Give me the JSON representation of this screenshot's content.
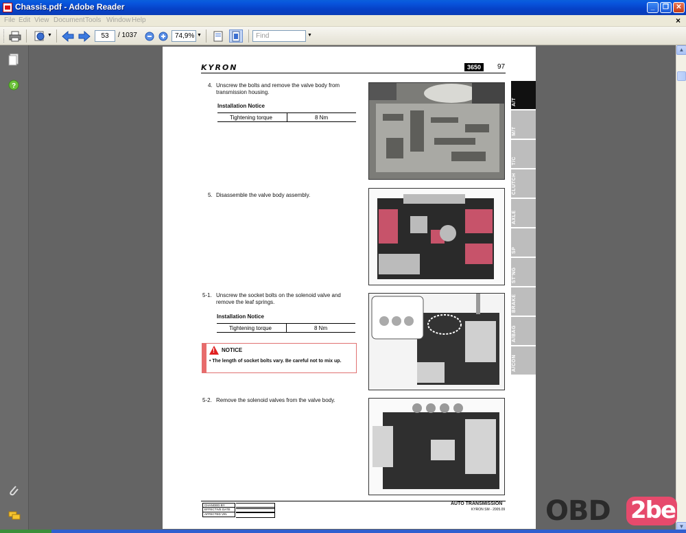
{
  "window": {
    "title": "Chassis.pdf - Adobe Reader"
  },
  "menu": {
    "items": [
      "File",
      "Edit",
      "View",
      "Document",
      "Tools",
      "Window",
      "Help"
    ]
  },
  "toolbar": {
    "page_current": "53",
    "page_total": "/ 1037",
    "zoom": "74,9%",
    "find_placeholder": "Find"
  },
  "icons": [
    "print-icon",
    "hand-tool-icon",
    "prev-page-icon",
    "next-page-icon",
    "zoom-out-icon",
    "zoom-in-icon",
    "fit-page-icon",
    "pages-icon",
    "help-icon",
    "attachment-icon",
    "comments-icon"
  ],
  "page": {
    "brand": "KYRON",
    "code": "3650",
    "number": "97",
    "steps": [
      {
        "num": "4.",
        "text_line1": "Unscrew the bolts and remove the valve body from",
        "text_line2": "transmission housing."
      },
      {
        "num": "5.",
        "text_line1": "Disassemble the valve body assembly."
      },
      {
        "num": "5-1.",
        "text_line1": "Unscrew the socket  bolts on the solenoid valve and",
        "text_line2": "remove the leaf springs."
      },
      {
        "num": "5-2.",
        "text_line1": "Remove the solenoid valves from the valve body."
      }
    ],
    "installation_notice_1": "Installation Notice",
    "installation_notice_2": "Installation Notice",
    "torque_label_1": "Tightening torque",
    "torque_value_1": "8 Nm",
    "torque_label_2": "Tightening torque",
    "torque_value_2": "8 Nm",
    "notice": {
      "title": "NOTICE",
      "text": "•  The length of socket bolts vary. Be careful not to mix up."
    },
    "side_tabs": [
      "A/T",
      "M/T",
      "T/C",
      "CLUTCH",
      "AXLE",
      "SP",
      "ST'NG",
      "BRAKE",
      "A/BAG",
      "A/CON"
    ],
    "footer": {
      "rows": [
        "CHANGED BY",
        "EFFECTIVE DATE",
        "AFFECTED VIN"
      ],
      "title": "AUTO TRANSMISSION",
      "sub": "KYRON SM - 2005.09"
    }
  },
  "watermark": {
    "text": "OBD",
    "badge": "2be"
  },
  "colors": {
    "titlebar": "#0a5fdc",
    "doc_bg": "#646464",
    "notice_red": "#e02020",
    "tab_active": "#111111",
    "tab_inactive": "#bdbdbd"
  }
}
